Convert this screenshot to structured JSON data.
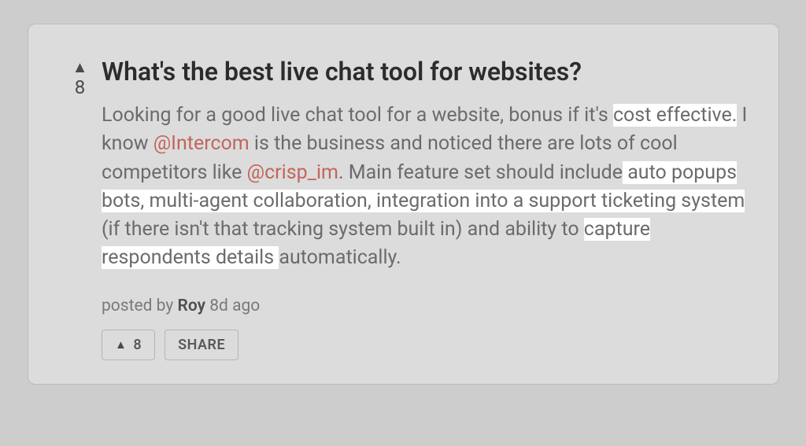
{
  "vote": {
    "count": "8"
  },
  "post": {
    "title": "What's the best live chat tool for websites?",
    "body": {
      "t1": "Looking for a good live chat tool for a website, bonus if it's ",
      "h1": "cost effective.",
      "t2": " I know ",
      "m1": "@Intercom",
      "t3": " is the business and noticed there are lots of cool competitors like ",
      "m2": "@crisp_im",
      "t4": ". Main feature set should include",
      "h2": " auto popups bots, multi-agent collaboration, integration into a support ticketing system ",
      "t5": "(if there isn't that tracking system built in) and ability to ",
      "h3": "capture respondents details ",
      "t6": "automatically."
    },
    "meta": {
      "prefix": "posted by ",
      "author": "Roy",
      "when": " 8d ago"
    }
  },
  "actions": {
    "upvote_count": "8",
    "share_label": "SHARE"
  }
}
